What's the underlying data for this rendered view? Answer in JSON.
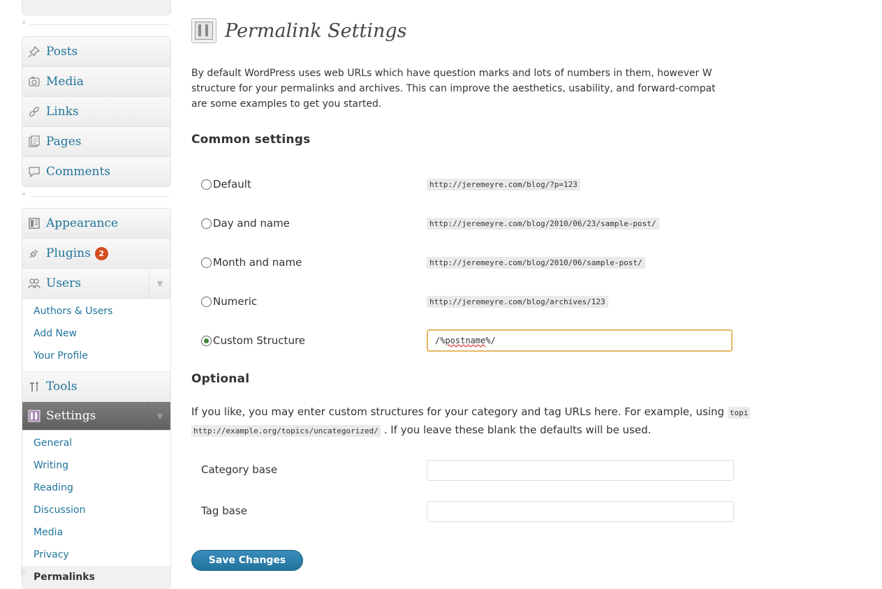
{
  "sidebar": {
    "group1": [
      {
        "label": "Posts",
        "icon": "pushpin-icon"
      },
      {
        "label": "Media",
        "icon": "media-icon"
      },
      {
        "label": "Links",
        "icon": "link-icon"
      },
      {
        "label": "Pages",
        "icon": "pages-icon"
      },
      {
        "label": "Comments",
        "icon": "comments-icon"
      }
    ],
    "group2": {
      "appearance": "Appearance",
      "plugins": "Plugins",
      "plugins_badge": "2",
      "users": "Users",
      "users_sub": [
        "Authors & Users",
        "Add New",
        "Your Profile"
      ],
      "tools": "Tools",
      "settings": "Settings",
      "settings_sub": [
        "General",
        "Writing",
        "Reading",
        "Discussion",
        "Media",
        "Privacy",
        "Permalinks"
      ]
    }
  },
  "page": {
    "title": "Permalink Settings",
    "intro_lines": [
      "By default WordPress uses web URLs which have question marks and lots of numbers in them, however W",
      "structure for your permalinks and archives. This can improve the aesthetics, usability, and forward-compat",
      "are some examples to get you started."
    ]
  },
  "common": {
    "heading": "Common settings",
    "options": [
      {
        "label": "Default",
        "example": "http://jeremeyre.com/blog/?p=123",
        "checked": false
      },
      {
        "label": "Day and name",
        "example": "http://jeremeyre.com/blog/2010/06/23/sample-post/",
        "checked": false
      },
      {
        "label": "Month and name",
        "example": "http://jeremeyre.com/blog/2010/06/sample-post/",
        "checked": false
      },
      {
        "label": "Numeric",
        "example": "http://jeremeyre.com/blog/archives/123",
        "checked": false
      },
      {
        "label": "Custom Structure",
        "checked": true
      }
    ],
    "custom_value_prefix": "/%",
    "custom_value_word": "postname",
    "custom_value_suffix": "%/"
  },
  "optional": {
    "heading": "Optional",
    "text_line1": "If you like, you may enter custom structures for your category and tag URLs here. For example, using",
    "text_code1": "topi",
    "text_code2": "http://example.org/topics/uncategorized/",
    "text_line2_rest": ". If you leave these blank the defaults will be used.",
    "category_label": "Category base",
    "category_value": "",
    "tag_label": "Tag base",
    "tag_value": ""
  },
  "actions": {
    "save_label": "Save Changes"
  },
  "colors": {
    "link": "#21759b",
    "badge": "#d54e21",
    "button": "#21759b",
    "focus_border": "#e5b765"
  }
}
